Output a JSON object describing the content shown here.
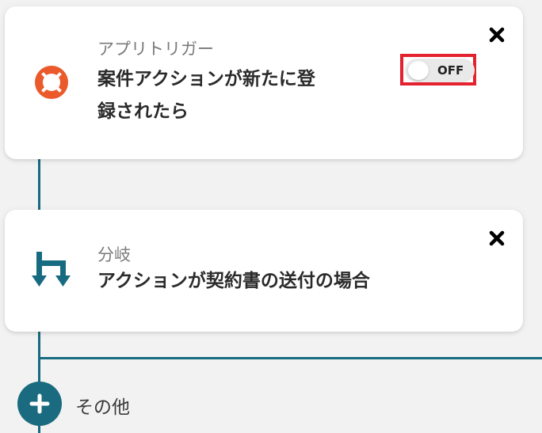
{
  "colors": {
    "connector": "#176b80",
    "trigger_icon": "#ea5a2b",
    "branch_icon": "#176b80",
    "highlight": "#e3212f"
  },
  "trigger_card": {
    "kind": "アプリトリガー",
    "title": "案件アクションが新たに登録されたら",
    "icon": "lifebuoy-icon",
    "toggle_label": "OFF",
    "toggle_on": false
  },
  "branch_card": {
    "kind": "分岐",
    "title": "アクションが契約書の送付の場合",
    "icon": "branch-icon"
  },
  "add_branch": {
    "label": "その他",
    "icon": "plus-icon"
  }
}
